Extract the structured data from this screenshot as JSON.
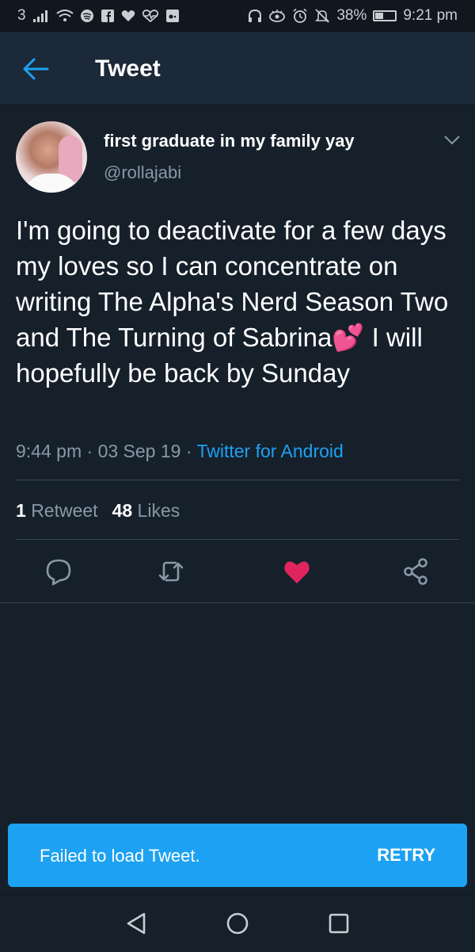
{
  "status_bar": {
    "carrier": "3",
    "signal_icon": "signal-bars-icon",
    "left_icons": [
      "wifi-icon",
      "spotify-icon",
      "facebook-icon",
      "heart-icon",
      "heart-rate-icon",
      "media-icon"
    ],
    "right_icons": [
      "headphones-icon",
      "eye-icon",
      "alarm-icon",
      "mute-icon"
    ],
    "battery": "38%",
    "battery_level": 0.38,
    "time": "9:21 pm"
  },
  "app_bar": {
    "back_icon": "arrow-left-icon",
    "title": "Tweet"
  },
  "tweet": {
    "display_name": "first graduate in my family yay",
    "handle": "@rollajabi",
    "text_before_emoji": "I'm going to deactivate for a few days my loves so I can concentrate on writing The Alpha's Nerd Season Two and The Turning of Sabrina",
    "emoji": "💕",
    "text_after_emoji": " I will hopefully be back by Sunday",
    "time": "9:44 pm",
    "separator": " · ",
    "date": "03 Sep 19",
    "source": "Twitter for Android",
    "retweet_count": "1",
    "retweet_label": "Retweet",
    "like_count": "48",
    "like_label": "Likes"
  },
  "actions": [
    {
      "icon": "reply-icon"
    },
    {
      "icon": "retweet-icon"
    },
    {
      "icon": "like-icon"
    },
    {
      "icon": "share-icon"
    }
  ],
  "toast": {
    "message": "Failed to load Tweet.",
    "action": "RETRY"
  },
  "nav_bar": {
    "buttons": [
      "back-triangle-icon",
      "home-circle-icon",
      "recents-square-icon"
    ]
  },
  "colors": {
    "background": "#15202b",
    "accent": "#1da1f2",
    "like": "#e0245e",
    "secondary_text": "#8899a6"
  }
}
